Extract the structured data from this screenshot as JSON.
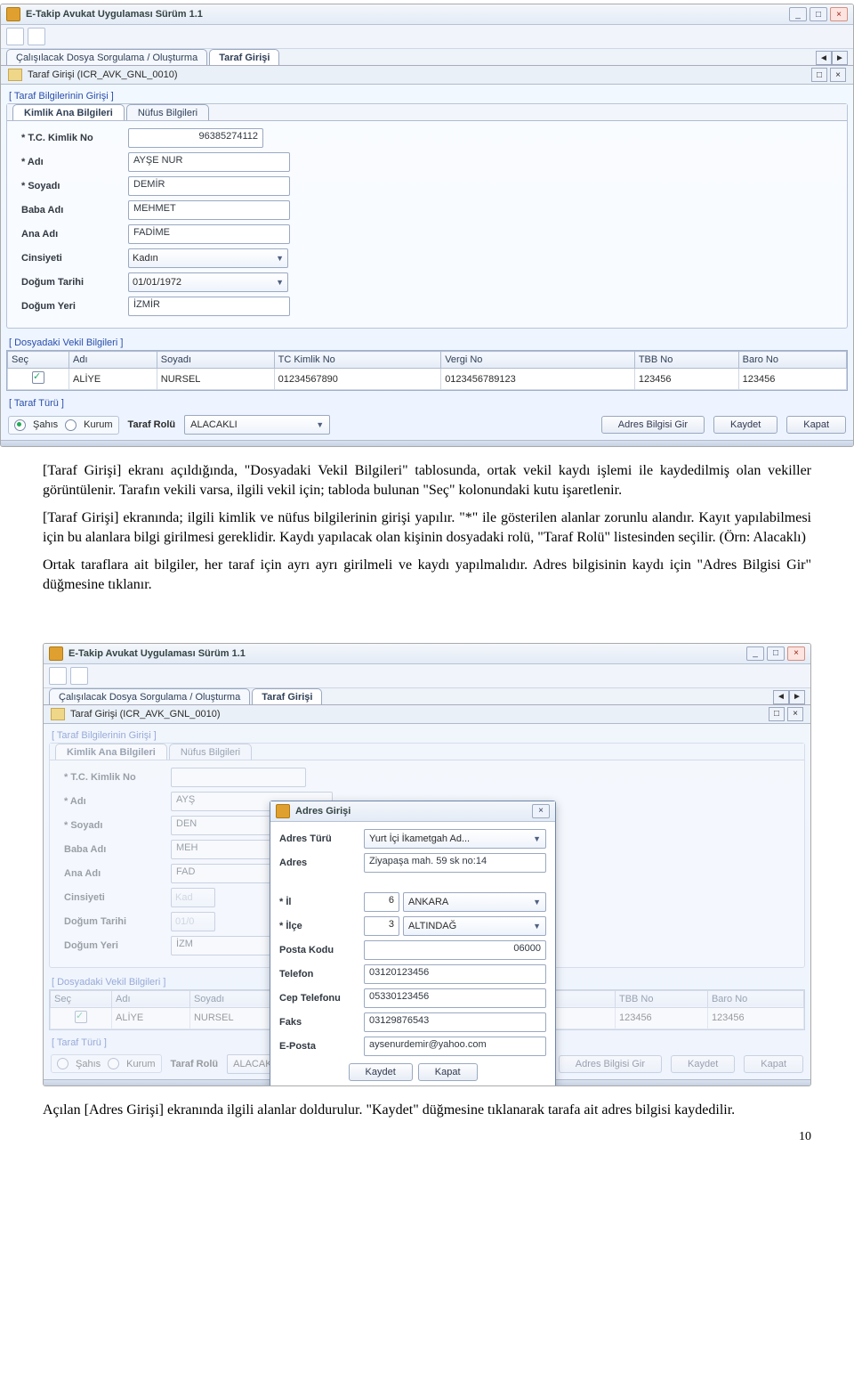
{
  "screenshot1": {
    "window_title": "E-Takip Avukat Uygulaması Sürüm 1.1",
    "main_tabs": [
      "Çalışılacak Dosya Sorgulama / Oluşturma",
      "Taraf Girişi"
    ],
    "main_tab_active": 1,
    "module_bar": "Taraf Girişi (ICR_AVK_GNL_0010)",
    "section_taraf": "[ Taraf Bilgilerinin Girişi ]",
    "inner_tabs": [
      "Kimlik Ana Bilgileri",
      "Nüfus Bilgileri"
    ],
    "form": {
      "tc_label": "* T.C. Kimlik No",
      "tc_val": "96385274112",
      "ad_label": "* Adı",
      "ad_val": "AYŞE NUR",
      "soyad_label": "* Soyadı",
      "soyad_val": "DEMİR",
      "baba_label": "Baba Adı",
      "baba_val": "MEHMET",
      "ana_label": "Ana Adı",
      "ana_val": "FADİME",
      "cins_label": "Cinsiyeti",
      "cins_val": "Kadın",
      "dogt_label": "Doğum Tarihi",
      "dogt_val": "01/01/1972",
      "dogy_label": "Doğum Yeri",
      "dogy_val": "İZMİR"
    },
    "section_vekil": "[ Dosyadaki Vekil Bilgileri ]",
    "grid_headers": [
      "Seç",
      "Adı",
      "Soyadı",
      "TC Kimlik No",
      "Vergi No",
      "TBB No",
      "Baro No"
    ],
    "grid_row": [
      "ALİYE",
      "NURSEL",
      "01234567890",
      "0123456789123",
      "123456",
      "123456"
    ],
    "section_taraf_turu": "[ Taraf Türü ]",
    "radios": {
      "sahis": "Şahıs",
      "kurum": "Kurum"
    },
    "rol_label": "Taraf Rolü",
    "rol_val": "ALACAKLI",
    "btn_adres": "Adres Bilgisi Gir",
    "btn_kaydet": "Kaydet",
    "btn_kapat": "Kapat"
  },
  "body_text": {
    "p1": "[Taraf Girişi] ekranı açıldığında, \"Dosyadaki Vekil Bilgileri\" tablosunda, ortak vekil kaydı işlemi ile kaydedilmiş olan vekiller görüntülenir. Tarafın vekili varsa, ilgili vekil için; tabloda bulunan \"Seç\" kolonundaki kutu işaretlenir.",
    "p2": "[Taraf Girişi] ekranında; ilgili kimlik ve nüfus bilgilerinin girişi yapılır. \"*\" ile gösterilen alanlar zorunlu alandır. Kayıt yapılabilmesi için bu alanlara bilgi girilmesi gereklidir. Kaydı yapılacak olan kişinin dosyadaki rolü, \"Taraf Rolü\" listesinden seçilir. (Örn: Alacaklı)",
    "p3": "Ortak taraflara ait bilgiler, her taraf için ayrı ayrı girilmeli ve kaydı yapılmalıdır. Adres bilgisinin kaydı için \"Adres Bilgisi Gir\" düğmesine tıklanır."
  },
  "screenshot2": {
    "dialog_title": "Adres Girişi",
    "dialog": {
      "adres_turu_label": "Adres Türü",
      "adres_turu_val": "Yurt İçi İkametgah Ad...",
      "adres_label": "Adres",
      "adres_val": "Ziyapaşa mah. 59 sk no:14",
      "il_label": "* İl",
      "il_code": "6",
      "il_val": "ANKARA",
      "ilce_label": "* İlçe",
      "ilce_code": "3",
      "ilce_val": "ALTINDAĞ",
      "posta_label": "Posta Kodu",
      "posta_val": "06000",
      "tel_label": "Telefon",
      "tel_val": "03120123456",
      "cep_label": "Cep Telefonu",
      "cep_val": "05330123456",
      "faks_label": "Faks",
      "faks_val": "03129876543",
      "email_label": "E-Posta",
      "email_val": "aysenurdemir@yahoo.com",
      "btn_kaydet": "Kaydet",
      "btn_kapat": "Kapat"
    }
  },
  "body_text2": {
    "p4": "Açılan [Adres Girişi]  ekranında ilgili alanlar doldurulur. \"Kaydet\" düğmesine tıklanarak tarafa ait adres bilgisi kaydedilir."
  },
  "page_number": "10"
}
